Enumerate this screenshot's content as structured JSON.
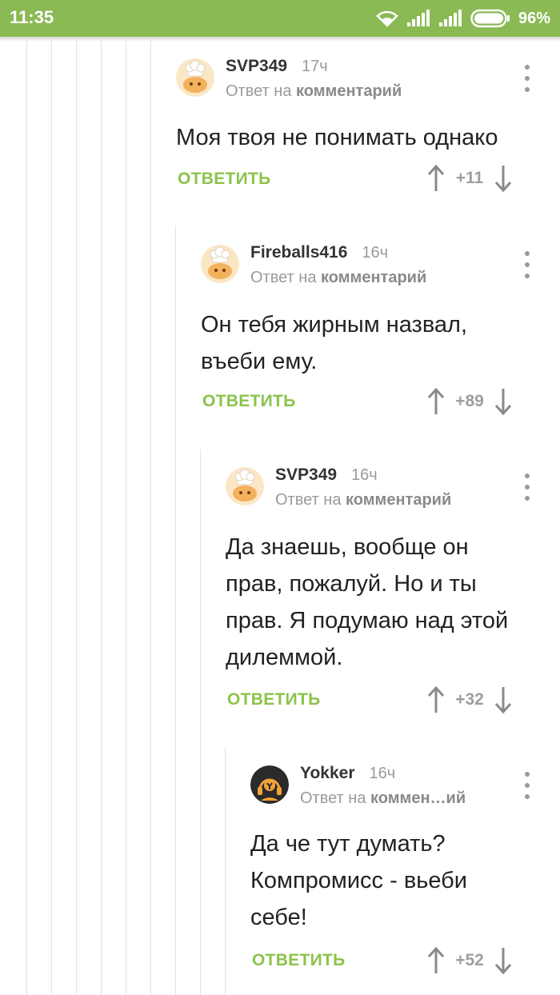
{
  "status_bar": {
    "time": "11:35",
    "battery_percent": "96%",
    "icons": [
      "wifi-icon",
      "signal-icon",
      "signal-icon",
      "battery-icon"
    ]
  },
  "colors": {
    "status_bar": "#8bb954",
    "reply_action": "#8bc34a",
    "muted_text": "#9a9a9a"
  },
  "comments": [
    {
      "author": "SVP349",
      "time": "17ч",
      "reply_prefix": "Ответ на",
      "reply_target": "комментарий",
      "lines": [
        "Моя твоя не понимать однако"
      ],
      "reply_label": "ОТВЕТИТЬ",
      "score": "+11",
      "avatar": "chef-cat-avatar"
    },
    {
      "author": "Fireballs416",
      "time": "16ч",
      "reply_prefix": "Ответ на",
      "reply_target": "комментарий",
      "lines": [
        "Он тебя жирным назвал,",
        "въеби ему."
      ],
      "reply_label": "ОТВЕТИТЬ",
      "score": "+89",
      "avatar": "chef-cat-avatar"
    },
    {
      "author": "SVP349",
      "time": "16ч",
      "reply_prefix": "Ответ на",
      "reply_target": "комментарий",
      "lines": [
        "Да знаешь, вообще он",
        "прав, пожалуй. Но и ты",
        "прав. Я подумаю над этой",
        "дилеммой."
      ],
      "reply_label": "ОТВЕТИТЬ",
      "score": "+32",
      "avatar": "chef-cat-avatar"
    },
    {
      "author": "Yokker",
      "time": "16ч",
      "reply_prefix": "Ответ на",
      "reply_target": "коммен…ий",
      "lines": [
        "Да че тут думать?",
        "Компромисс - вьеби",
        "себе!"
      ],
      "reply_label": "ОТВЕТИТЬ",
      "score": "+52",
      "avatar": "headphones-avatar"
    }
  ]
}
